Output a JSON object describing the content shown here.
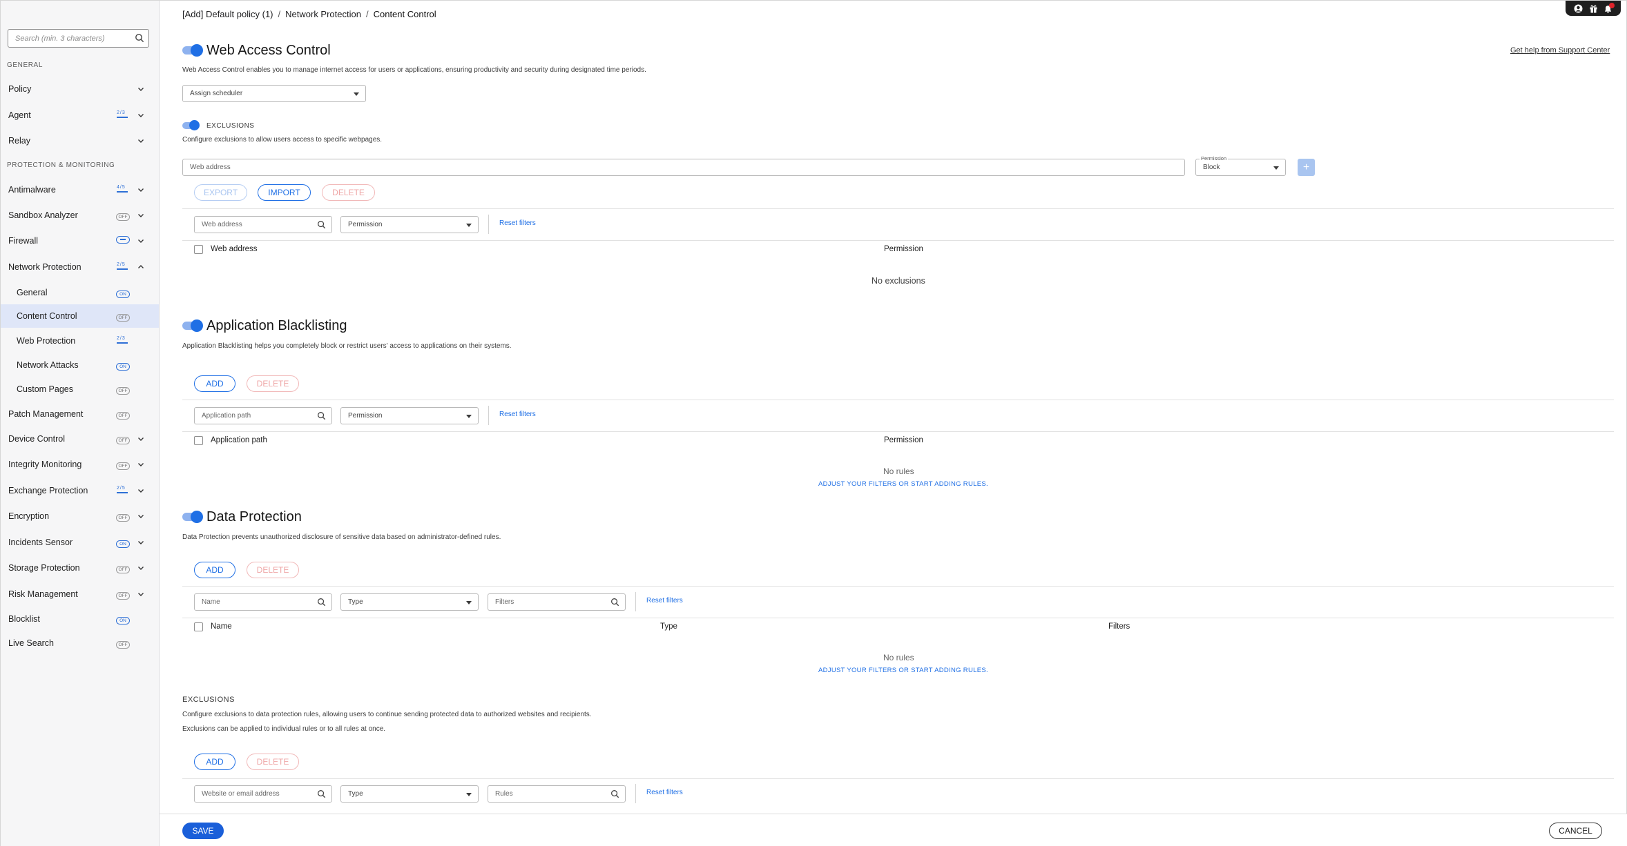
{
  "sidebar": {
    "search_placeholder": "Search (min. 3 characters)",
    "groups": {
      "general": "GENERAL",
      "protection": "PROTECTION & MONITORING"
    },
    "items": {
      "policy": "Policy",
      "agent": "Agent",
      "relay": "Relay",
      "antimalware": "Antimalware",
      "sandbox": "Sandbox Analyzer",
      "firewall": "Firewall",
      "network": "Network Protection",
      "general_sub": "General",
      "content_control": "Content Control",
      "web_protection": "Web Protection",
      "network_attacks": "Network Attacks",
      "custom_pages": "Custom Pages",
      "patch": "Patch Management",
      "device": "Device Control",
      "integrity": "Integrity Monitoring",
      "exchange": "Exchange Protection",
      "encryption": "Encryption",
      "incidents": "Incidents Sensor",
      "storage": "Storage Protection",
      "risk": "Risk Management",
      "blocklist": "Blocklist",
      "live_search": "Live Search"
    },
    "badges": {
      "on": "ON",
      "off": "OFF"
    }
  },
  "breadcrumb": {
    "policy": "[Add] Default policy (1)",
    "section": "Network Protection",
    "current": "Content Control",
    "sep": "/"
  },
  "help_link": "Get help from Support Center",
  "wac": {
    "title": "Web Access Control",
    "desc": "Web Access Control enables you to manage internet access for users or applications, ensuring productivity and security during designated time periods.",
    "scheduler": "Assign scheduler",
    "exclusions_label": "EXCLUSIONS",
    "exclusions_desc": "Configure exclusions to allow users access to specific webpages.",
    "web_address_placeholder": "Web address",
    "permission_label": "Permission",
    "permission_value": "Block",
    "add_symbol": "+",
    "export": "EXPORT",
    "import": "IMPORT",
    "delete": "DELETE",
    "filter_web_address": "Web address",
    "filter_permission": "Permission",
    "reset_filters": "Reset filters",
    "col_web_address": "Web address",
    "col_permission": "Permission",
    "empty": "No exclusions"
  },
  "ab": {
    "title": "Application Blacklisting",
    "desc": "Application Blacklisting helps you completely block or restrict users' access to applications on their systems.",
    "add": "ADD",
    "delete": "DELETE",
    "filter_path": "Application path",
    "filter_permission": "Permission",
    "reset_filters": "Reset filters",
    "col_path": "Application path",
    "col_permission": "Permission",
    "empty": "No rules",
    "adjust": "ADJUST YOUR FILTERS OR START ADDING RULES."
  },
  "dp": {
    "title": "Data Protection",
    "desc": "Data Protection prevents unauthorized disclosure of sensitive data based on administrator-defined rules.",
    "add": "ADD",
    "delete": "DELETE",
    "filter_name": "Name",
    "filter_type": "Type",
    "filter_filters": "Filters",
    "reset_filters": "Reset filters",
    "col_name": "Name",
    "col_type": "Type",
    "col_filters": "Filters",
    "empty": "No rules",
    "adjust": "ADJUST YOUR FILTERS OR START ADDING RULES.",
    "exclusions_label": "EXCLUSIONS",
    "exclusions_desc1": "Configure exclusions to data protection rules, allowing users to continue sending protected data to authorized websites and recipients.",
    "exclusions_desc2": "Exclusions can be applied to individual rules or to all rules at once.",
    "ex_add": "ADD",
    "ex_delete": "DELETE",
    "filter_website": "Website or email address",
    "filter_ex_type": "Type",
    "filter_rules": "Rules",
    "ex_reset_filters": "Reset filters"
  },
  "footer": {
    "save": "SAVE",
    "cancel": "CANCEL"
  },
  "colors": {
    "accent": "#1f6fe5",
    "save": "#1a5fd9",
    "danger_disabled": "#efa6a6",
    "active_row": "#dfe6f8"
  }
}
